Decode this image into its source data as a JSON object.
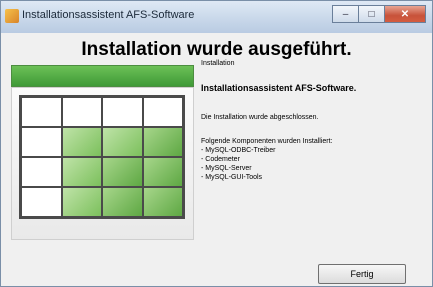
{
  "window": {
    "title": "Installationsassistent AFS-Software",
    "icon": "installer-icon"
  },
  "caption_buttons": {
    "minimize": "–",
    "maximize": "□",
    "close": "✕"
  },
  "heading": "Installation wurde ausgeführt.",
  "panel": {
    "small_label": "Installation",
    "title": "Installationsassistent AFS-Software.",
    "message": "Die Installation wurde abgeschlossen.",
    "components_heading": "Folgende Komponenten wurden Installiert:",
    "components": [
      "- MySQL-ODBC-Treiber",
      "- Codemeter",
      "- MySQL-Server",
      "- MySQL-GUI-Tools"
    ]
  },
  "buttons": {
    "finish": "Fertig"
  },
  "colors": {
    "accent_green": "#4fa842",
    "titlebar": "#c9d8ea",
    "close": "#c7523a"
  }
}
